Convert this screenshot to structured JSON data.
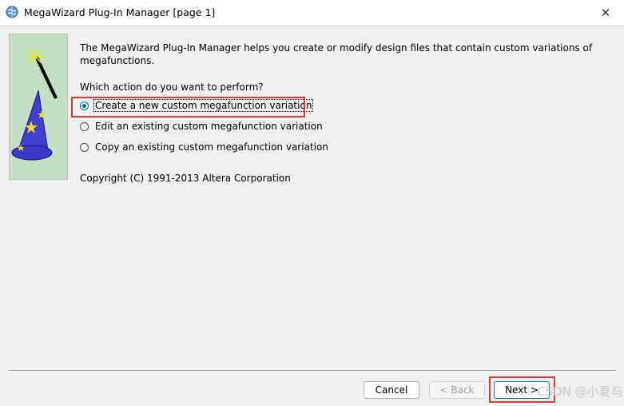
{
  "window": {
    "title": "MegaWizard Plug-In Manager [page 1]",
    "close_glyph": "✕"
  },
  "intro_text": "The MegaWizard Plug-In Manager helps you create or modify design files that contain custom variations of megafunctions.",
  "question": "Which action do you want to perform?",
  "options": [
    {
      "label": "Create a new custom megafunction variation",
      "selected": true
    },
    {
      "label": "Edit an existing custom megafunction variation",
      "selected": false
    },
    {
      "label": "Copy an existing custom megafunction variation",
      "selected": false
    }
  ],
  "copyright": "Copyright (C) 1991-2013 Altera Corporation",
  "buttons": {
    "cancel": "Cancel",
    "back": "< Back",
    "next": "Next >"
  },
  "watermark": "CSDN @小夏与酒",
  "colors": {
    "highlight": "#e03a3a",
    "wizard_panel_bg": "#c2dfc3",
    "radio_accent": "#0063b1"
  }
}
